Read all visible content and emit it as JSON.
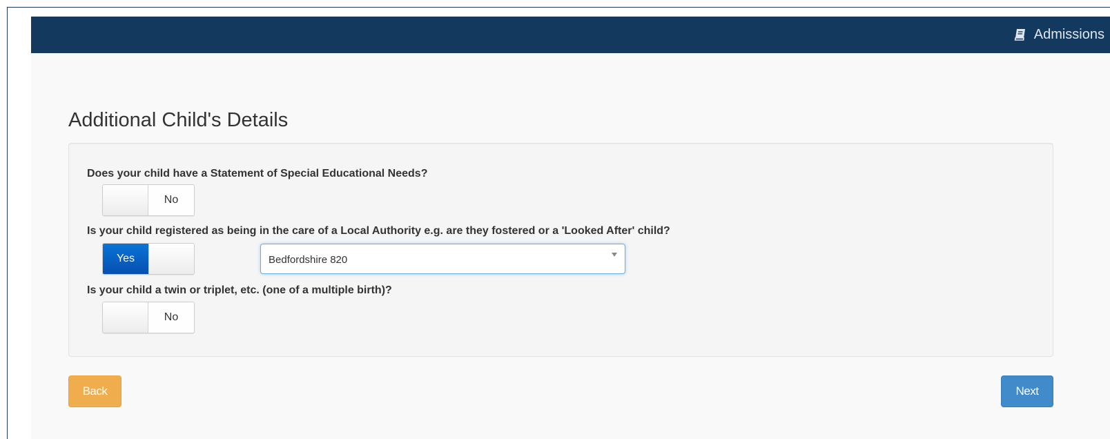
{
  "navbar": {
    "brand_label": "Admissions",
    "brand_icon": "book-icon",
    "background": "#133a5e"
  },
  "page": {
    "title": "Additional Child's Details"
  },
  "form": {
    "questions": [
      {
        "label": "Does your child have a Statement of Special Educational Needs?",
        "toggle_value": "No",
        "toggle_on": false
      },
      {
        "label": "Is your child registered as being in the care of a Local Authority e.g. are they fostered or a 'Looked After' child?",
        "toggle_value": "Yes",
        "toggle_on": true,
        "authority_select": {
          "selected": "Bedfordshire 820"
        }
      },
      {
        "label": "Is your child a twin or triplet, etc. (one of a multiple birth)?",
        "toggle_value": "No",
        "toggle_on": false
      }
    ]
  },
  "actions": {
    "back_label": "Back",
    "next_label": "Next",
    "back_color": "#f0ad4e",
    "next_color": "#428bca"
  }
}
